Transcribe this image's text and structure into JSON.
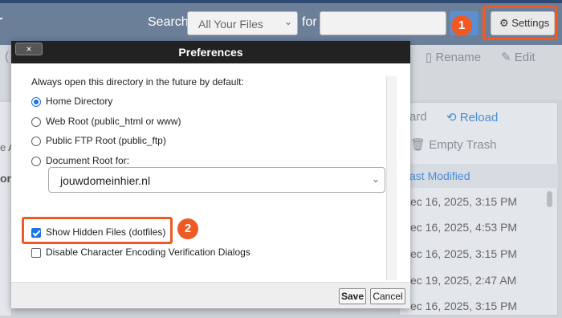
{
  "header": {
    "app_letter": "r",
    "search_label": "Search",
    "search_scope": "All Your Files",
    "for_label": "for",
    "search_value": "",
    "settings_label": "Settings",
    "step1_badge": "1"
  },
  "toolbar": {
    "rename_label": "Rename",
    "edit_label": "Edit",
    "partial_left_1": "(",
    "partial_left_2": "e A",
    "partial_left_3": "on"
  },
  "file_panel": {
    "partial_label": "ard",
    "reload_label": "Reload",
    "empty_trash_label": "Empty Trash",
    "last_modified_header": "ast Modified",
    "dates": [
      "ec 16, 2025, 3:15 PM",
      "ec 16, 2025, 4:53 PM",
      "ec 16, 2025, 3:15 PM",
      "ec 19, 2025, 2:47 AM",
      "ec 16, 2025, 3:15 PM"
    ]
  },
  "dialog": {
    "title": "Preferences",
    "close_label": "×",
    "heading": "Always open this directory in the future by default:",
    "radio_options": [
      {
        "label": "Home Directory",
        "selected": true
      },
      {
        "label": "Web Root (public_html or www)",
        "selected": false
      },
      {
        "label": "Public FTP Root (public_ftp)",
        "selected": false
      },
      {
        "label": "Document Root for:",
        "selected": false
      }
    ],
    "document_root_value": "jouwdomeinhier.nl",
    "checkboxes": [
      {
        "label": "Show Hidden Files (dotfiles)",
        "checked": true
      },
      {
        "label": "Disable Character Encoding Verification Dialogs",
        "checked": false
      }
    ],
    "step2_badge": "2",
    "save_label": "Save",
    "cancel_label": "Cancel"
  },
  "colors": {
    "accent": "#ef5a24",
    "header_bg": "#6b7f99",
    "link_blue": "#4a8cd6",
    "dialog_title_bg": "#222222"
  }
}
